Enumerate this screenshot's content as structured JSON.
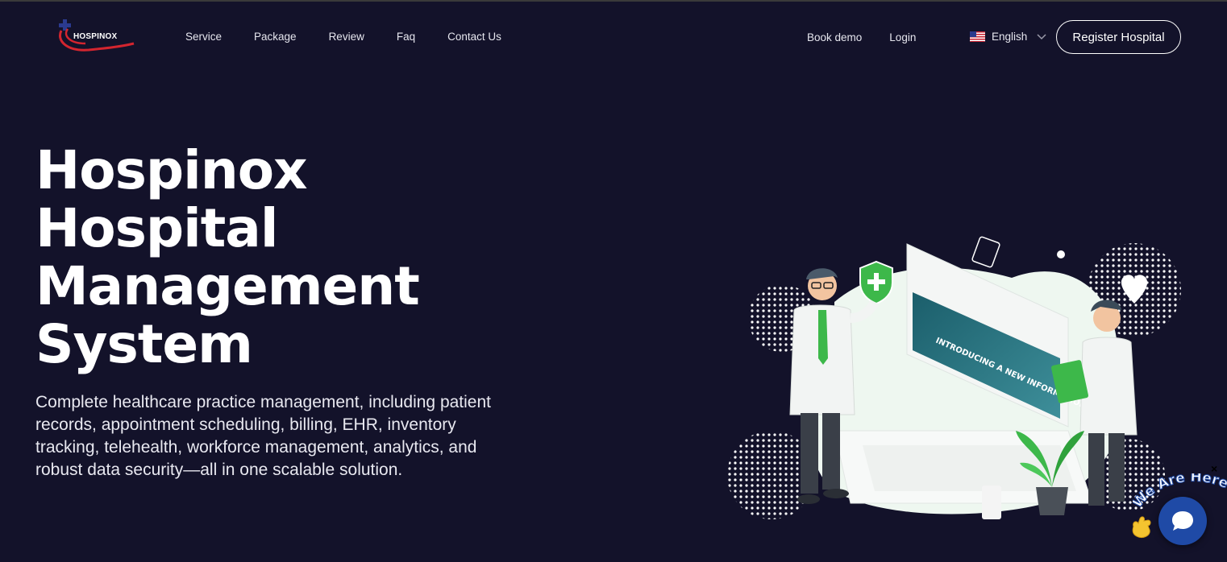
{
  "header": {
    "logo_text": "HOSPINOX",
    "nav_left": [
      "Service",
      "Package",
      "Review",
      "Faq",
      "Contact Us"
    ],
    "nav_right": [
      "Book demo",
      "Login"
    ],
    "language": {
      "label": "English",
      "flag_icon": "us-flag-icon"
    },
    "register_label": "Register Hospital"
  },
  "hero": {
    "title_lines": [
      "Hospinox",
      "Hospital",
      "Management",
      "System"
    ],
    "description": "Complete healthcare practice management, including patient records, appointment scheduling, billing, EHR, inventory tracking, telehealth, workforce management, analytics, and robust data security—all in one scalable solution.",
    "illustration": {
      "screen_text": "INTRODUCING A NEW INFORMATION SYSTEM"
    }
  },
  "chat_widget": {
    "banner_text": "We Are Here!",
    "close_label": "×"
  },
  "colors": {
    "background": "#13122a",
    "accent_green": "#3db84a",
    "logo_red": "#d4252f",
    "logo_blue": "#2b3a8f",
    "chat_blue": "#1f4aa6"
  }
}
